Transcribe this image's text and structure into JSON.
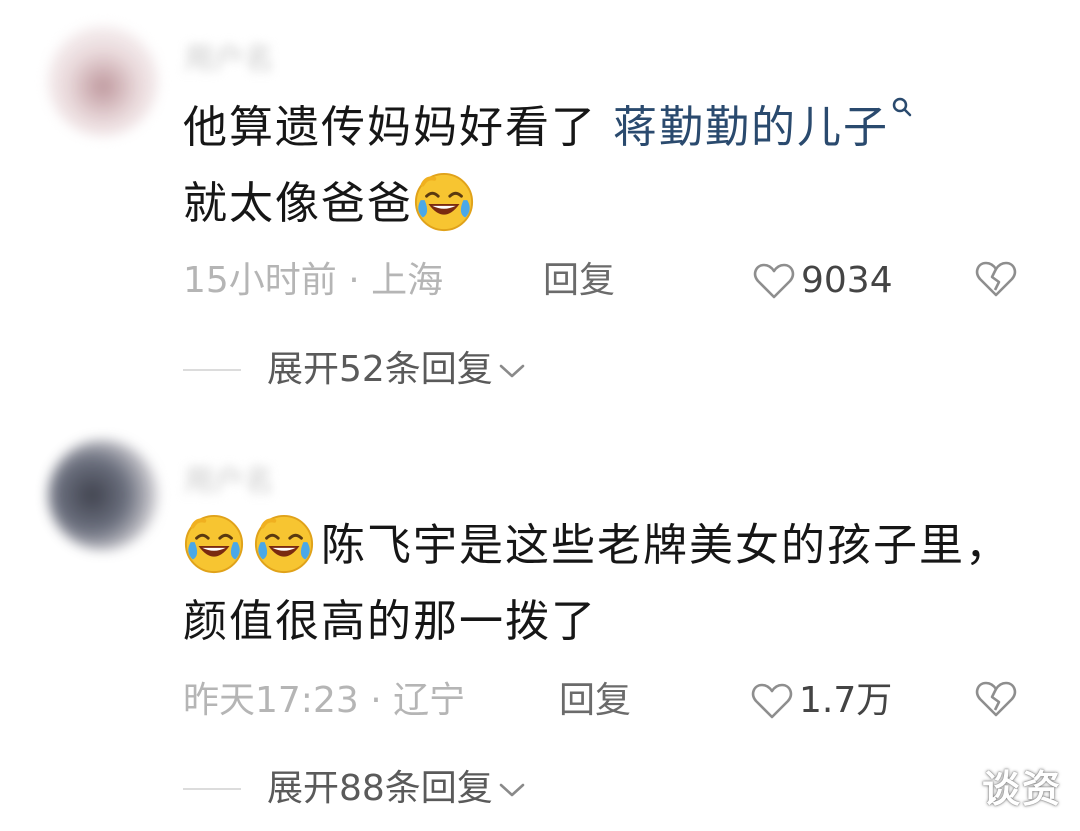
{
  "comments": [
    {
      "username": "用户名",
      "text_before": "他算遗传妈妈好看了 ",
      "link_text": "蒋勤勤的儿子",
      "text_after": "就太像爸爸",
      "time_location": "15小时前 · 上海",
      "reply_label": "回复",
      "like_count": "9034",
      "expand_label": "展开52条回复"
    },
    {
      "username": "用户名",
      "text": "陈飞宇是这些老牌美女的孩子里，颜值很高的那一拨了",
      "time_location": "昨天17:23 · 辽宁",
      "reply_label": "回复",
      "like_count": "1.7万",
      "expand_label": "展开88条回复"
    }
  ],
  "watermark": "谈资",
  "icons": [
    "search-icon",
    "laughing-crying-emoji",
    "heart-icon",
    "broken-heart-icon",
    "chevron-down-icon"
  ],
  "colors": {
    "link": "#2a4a6e",
    "meta": "#b5b5b5",
    "text": "#161616"
  }
}
